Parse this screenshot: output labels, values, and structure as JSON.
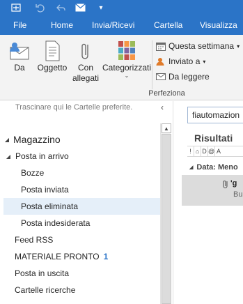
{
  "quick_access": {
    "icons": [
      "send-receive-icon",
      "undo-icon",
      "reply-icon",
      "envelope-icon",
      "customize-dropdown-icon"
    ]
  },
  "tabs": [
    {
      "label": "File"
    },
    {
      "label": "Home"
    },
    {
      "label": "Invia/Ricevi"
    },
    {
      "label": "Cartella"
    },
    {
      "label": "Visualizza"
    }
  ],
  "ribbon": {
    "buttons": {
      "da": "Da",
      "oggetto": "Oggetto",
      "con_allegati_1": "Con",
      "con_allegati_2": "allegati",
      "categorizzati": "Categorizzati"
    },
    "small": {
      "questa_settimana": "Questa settimana",
      "inviato_a": "Inviato a",
      "da_leggere": "Da leggere"
    },
    "group_label": "Perfeziona"
  },
  "folder_pane": {
    "favorites_hint": "Trascinare qui le Cartelle preferite.",
    "account": "Magazzino",
    "folders": [
      {
        "label": "Posta in arrivo",
        "expandable": true
      },
      {
        "label": "Bozze"
      },
      {
        "label": "Posta inviata"
      },
      {
        "label": "Posta eliminata",
        "selected": true
      },
      {
        "label": "Posta indesiderata"
      },
      {
        "label": "Feed RSS"
      },
      {
        "label": "MATERIALE PRONTO",
        "count": "1"
      },
      {
        "label": "Posta in uscita"
      },
      {
        "label": "Cartelle ricerche"
      }
    ]
  },
  "results_pane": {
    "search_value": "fiautomazion",
    "title": "Risultati",
    "column_headers": [
      "!",
      "⌂",
      "D",
      "@",
      "A"
    ],
    "group_label": "Data: Meno",
    "message": {
      "sender": "'g",
      "preview": "Bu"
    }
  },
  "colors": {
    "accent": "#2b74c7",
    "selected_folder": "#e5eff9",
    "unread_count": "#2b74c7"
  }
}
